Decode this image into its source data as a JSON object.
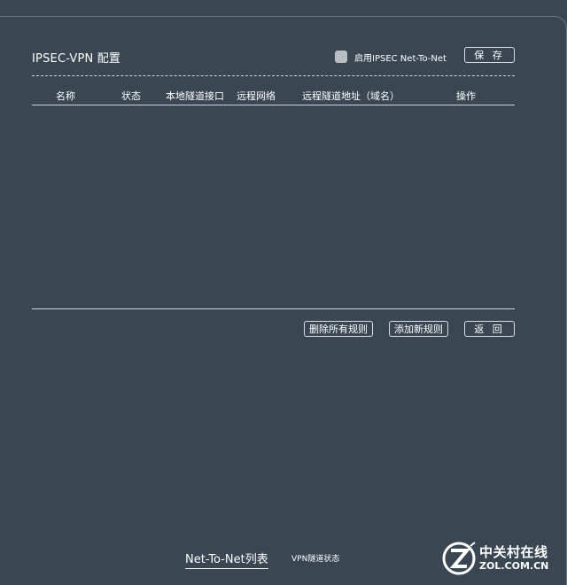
{
  "page": {
    "title": "IPSEC-VPN 配置",
    "enable_label": "启用IPSEC Net-To-Net",
    "enable_checked": false,
    "save_label": "保 存"
  },
  "table": {
    "columns": [
      "名称",
      "状态",
      "本地隧道接口",
      "远程网络",
      "远程隧道地址（域名）",
      "操作"
    ],
    "rows": []
  },
  "actions": {
    "delete_all_label": "删除所有规则",
    "add_new_label": "添加新规则",
    "back_label": "返 回"
  },
  "bottom_tabs": {
    "active": "Net-To-Net列表",
    "other": "VPN隧道状态"
  },
  "watermark": {
    "cn": "中关村在线",
    "en": "ZOL.COM.CN"
  },
  "colors": {
    "background": "#3a4652",
    "text": "#ffffff",
    "checkbox": "#b9bec4"
  }
}
